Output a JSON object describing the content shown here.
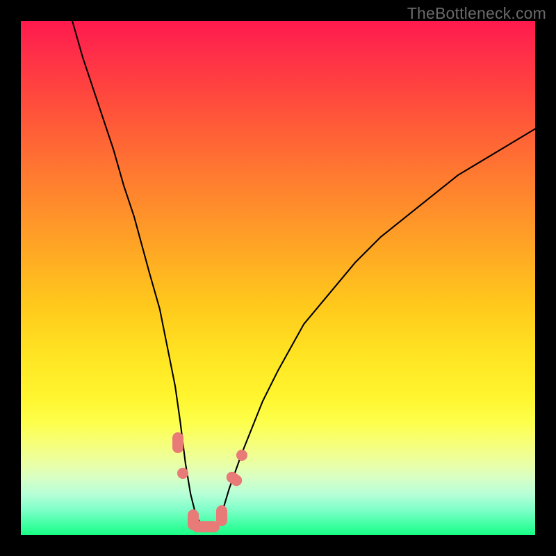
{
  "watermark": "TheBottleneck.com",
  "colors": {
    "frame": "#000000",
    "watermark": "#6a6a6a",
    "curve": "#000000",
    "marker": "#e87a78",
    "gradient_top": "#ff1a4d",
    "gradient_bottom": "#18ff85"
  },
  "chart_data": {
    "type": "line",
    "title": "",
    "xlabel": "",
    "ylabel": "",
    "xlim": [
      0,
      100
    ],
    "ylim": [
      0,
      100
    ],
    "grid": false,
    "legend_position": "none",
    "series": [
      {
        "name": "bottleneck-curve",
        "x": [
          10,
          12,
          15,
          18,
          20,
          22,
          25,
          27,
          30,
          31,
          32,
          33,
          34,
          35,
          36,
          37,
          38,
          39,
          40.5,
          43,
          45,
          47,
          50,
          55,
          60,
          65,
          70,
          75,
          80,
          85,
          90,
          95,
          100
        ],
        "y": [
          100,
          93,
          84,
          75,
          68,
          62,
          51,
          44,
          29,
          22,
          14,
          8,
          4,
          2,
          1.6,
          1.6,
          2,
          4,
          9,
          16,
          21,
          26,
          32,
          41,
          47,
          53,
          58,
          62,
          66,
          70,
          73,
          76,
          79
        ]
      }
    ],
    "markers": [
      {
        "name": "point-a",
        "x": 30.5,
        "y": 18,
        "shape": "pill-v"
      },
      {
        "name": "point-b",
        "x": 31.5,
        "y": 12,
        "shape": "dot"
      },
      {
        "name": "point-c",
        "x": 33.5,
        "y": 3.0,
        "shape": "pill-v"
      },
      {
        "name": "point-d",
        "x": 36.0,
        "y": 1.6,
        "shape": "pill-h"
      },
      {
        "name": "point-e",
        "x": 39.0,
        "y": 3.8,
        "shape": "pill-v"
      },
      {
        "name": "point-f",
        "x": 41.5,
        "y": 11,
        "shape": "pill-dh"
      },
      {
        "name": "point-g",
        "x": 43.0,
        "y": 15.5,
        "shape": "dot"
      }
    ],
    "curve_min_x": 36,
    "curve_min_y": 1.6
  }
}
